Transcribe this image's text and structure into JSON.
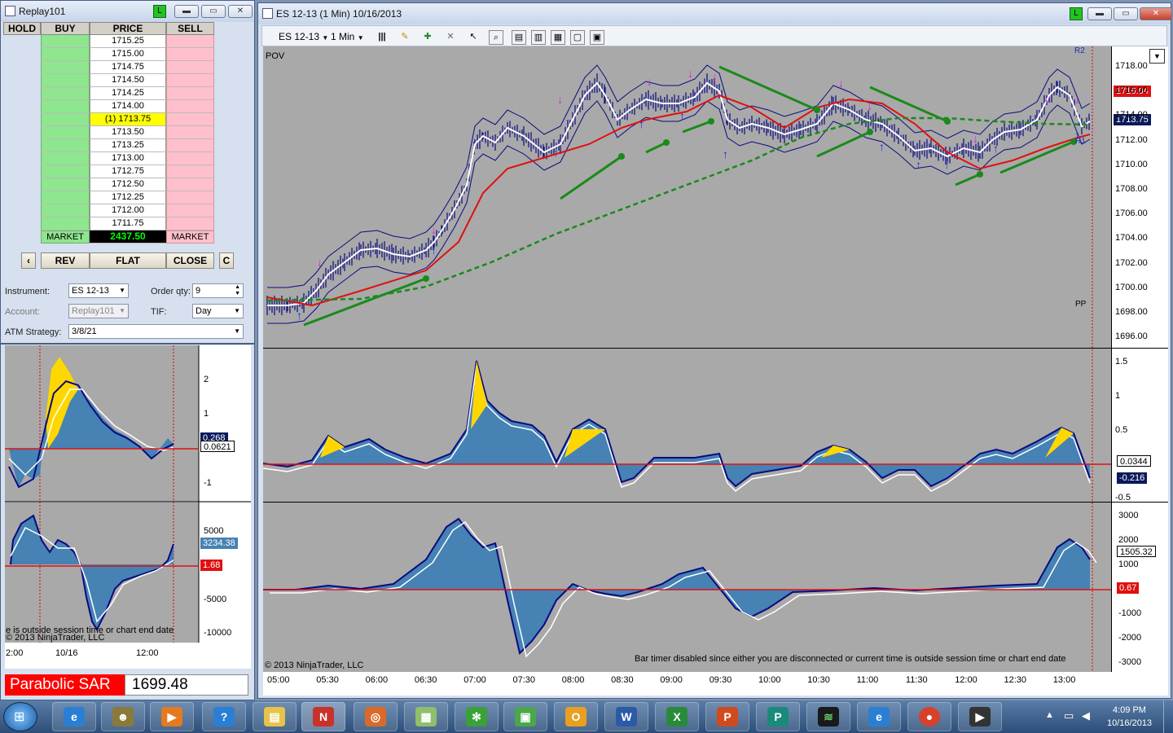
{
  "dom_window": {
    "title": "Replay101",
    "badge": "L",
    "headers": {
      "hold": "HOLD",
      "buy": "BUY",
      "price": "PRICE",
      "sell": "SELL"
    },
    "prices": [
      "1715.25",
      "1715.00",
      "1714.75",
      "1714.50",
      "1714.25",
      "1714.00",
      "(1) 1713.75",
      "1713.50",
      "1713.25",
      "1713.00",
      "1712.75",
      "1712.50",
      "1712.25",
      "1712.00",
      "1711.75"
    ],
    "market_buy": "MARKET",
    "market_sell": "MARKET",
    "pnl": "2437.50",
    "buttons": {
      "left": "‹",
      "rev": "REV",
      "flat": "FLAT",
      "close": "CLOSE",
      "c": "C"
    },
    "instrument_label": "Instrument:",
    "instrument_value": "ES 12-13",
    "order_qty_label": "Order qty:",
    "order_qty_value": "9",
    "account_label": "Account:",
    "account_value": "Replay101",
    "tif_label": "TIF:",
    "tif_value": "Day",
    "atm_label": "ATM Strategy:",
    "atm_value": "3/8/21"
  },
  "small_chart": {
    "osc1_ticks": [
      "2",
      "1",
      "-1"
    ],
    "osc1_tag_a": "0.268",
    "osc1_tag_b": "0.0621",
    "osc2_ticks": [
      "5000",
      "-5000",
      "-10000"
    ],
    "osc2_tag_a": "3234.38",
    "osc2_tag_b": "1.68",
    "message": "e is outside session time or chart end date",
    "copyright": "© 2013 NinjaTrader, LLC",
    "x_ticks": [
      "2:00",
      "10/16",
      "12:00"
    ],
    "sar_label": "Parabolic SAR",
    "sar_value": "1699.48"
  },
  "main_chart": {
    "title": "ES 12-13 (1 Min)  10/16/2013",
    "badge": "L",
    "toolbar": {
      "instrument": "ES 12-13",
      "interval": "1 Min"
    },
    "pov_label": "POV",
    "price_ticks": [
      "1718.00",
      "1716.00",
      "1714.00",
      "1712.00",
      "1710.00",
      "1708.00",
      "1706.00",
      "1704.00",
      "1702.00",
      "1700.00",
      "1698.00",
      "1696.00"
    ],
    "price_tag_red": "1716.04",
    "price_tag_last": "1713.75",
    "pivot_labels": {
      "r2": "R2",
      "r1": "R1",
      "pp": "PP"
    },
    "osc_ticks": [
      "1.5",
      "1",
      "0.5",
      "-0.5"
    ],
    "osc_tag_a": "0.0344",
    "osc_tag_b": "-0.216",
    "vol_ticks": [
      "3000",
      "2000",
      "1000",
      "-1000",
      "-2000",
      "-3000"
    ],
    "vol_tag_a": "1505.32",
    "vol_tag_b": "0.67",
    "copyright": "© 2013 NinjaTrader, LLC",
    "bar_timer_message": "Bar timer disabled since either you are disconnected or current time is outside session time or chart end date",
    "time_ticks": [
      "05:00",
      "05:30",
      "06:00",
      "06:30",
      "07:00",
      "07:30",
      "08:00",
      "08:30",
      "09:00",
      "09:30",
      "10:00",
      "10:30",
      "11:00",
      "11:30",
      "12:00",
      "12:30",
      "13:00"
    ]
  },
  "taskbar": {
    "clock_time": "4:09 PM",
    "clock_date": "10/16/2013"
  },
  "colors": {
    "chart_bg": "#a9a9a9",
    "ma_red": "#e01010",
    "ma_green": "#1a8a1a",
    "osc_fill": "#4682b4",
    "osc_hi": "#ffd700"
  }
}
